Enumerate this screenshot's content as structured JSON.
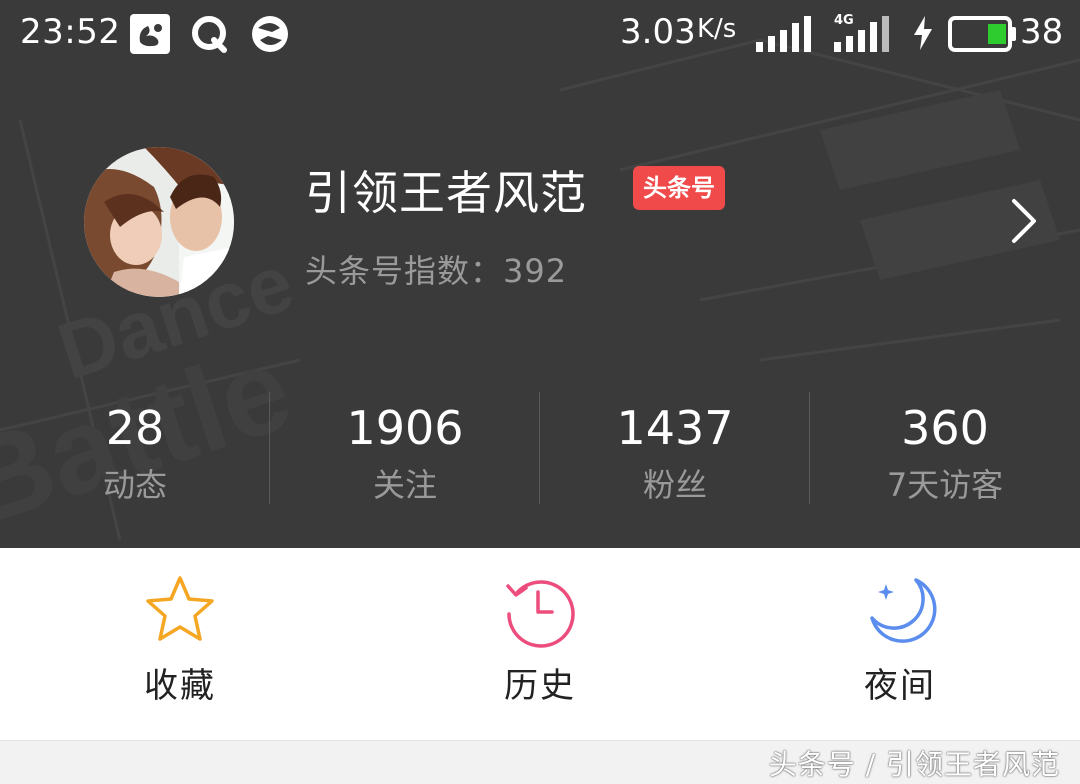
{
  "status_bar": {
    "time": "23:52",
    "network_speed": "3.03",
    "network_speed_unit": "K/s",
    "network_type": "4G",
    "battery_level": "38",
    "icons": [
      "uc-browser-icon",
      "q-app-icon",
      "sync-app-icon",
      "signal-icon",
      "signal-4g-icon",
      "charging-icon",
      "battery-icon"
    ]
  },
  "profile": {
    "name": "引领王者风范",
    "badge": "头条号",
    "index_text": "头条号指数：392"
  },
  "stats": [
    {
      "value": "28",
      "label": "动态"
    },
    {
      "value": "1906",
      "label": "关注"
    },
    {
      "value": "1437",
      "label": "粉丝"
    },
    {
      "value": "360",
      "label": "7天访客"
    }
  ],
  "actions": [
    {
      "label": "收藏",
      "icon": "star-icon",
      "color": "#f5a623"
    },
    {
      "label": "历史",
      "icon": "history-clock-icon",
      "color": "#ec4d7c"
    },
    {
      "label": "夜间",
      "icon": "moon-icon",
      "color": "#5b8def"
    }
  ],
  "footer": {
    "caption": "头条号 / 引领王者风范"
  },
  "colors": {
    "header_bg": "#3a3a3a",
    "badge_bg": "#f04a4a",
    "muted_text": "#9a9a9a"
  }
}
